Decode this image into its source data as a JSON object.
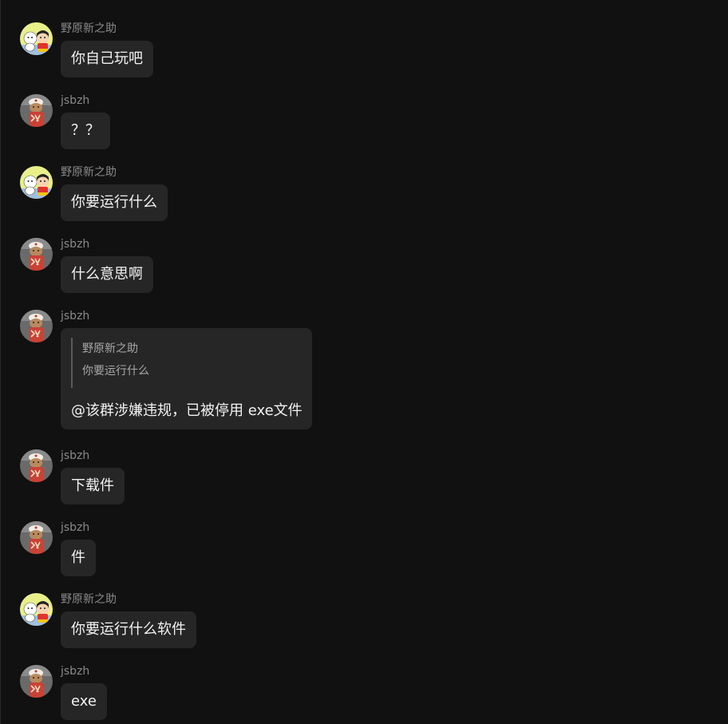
{
  "messages": [
    {
      "sender": "野原新之助",
      "avatar": "shinchan-avatar",
      "text": "你自己玩吧"
    },
    {
      "sender": "jsbzh",
      "avatar": "monkey-avatar",
      "text": "？？"
    },
    {
      "sender": "野原新之助",
      "avatar": "shinchan-avatar",
      "text": "你要运行什么"
    },
    {
      "sender": "jsbzh",
      "avatar": "monkey-avatar",
      "text": "什么意思啊"
    },
    {
      "sender": "jsbzh",
      "avatar": "monkey-avatar",
      "quote_sender": "野原新之助",
      "quote_text": "你要运行什么",
      "text": "@该群涉嫌违规，已被停用 exe文件"
    },
    {
      "sender": "jsbzh",
      "avatar": "monkey-avatar",
      "text": "下载件"
    },
    {
      "sender": "jsbzh",
      "avatar": "monkey-avatar",
      "text": "件"
    },
    {
      "sender": "野原新之助",
      "avatar": "shinchan-avatar",
      "text": "你要运行什么软件"
    },
    {
      "sender": "jsbzh",
      "avatar": "monkey-avatar",
      "text": "exe"
    }
  ]
}
